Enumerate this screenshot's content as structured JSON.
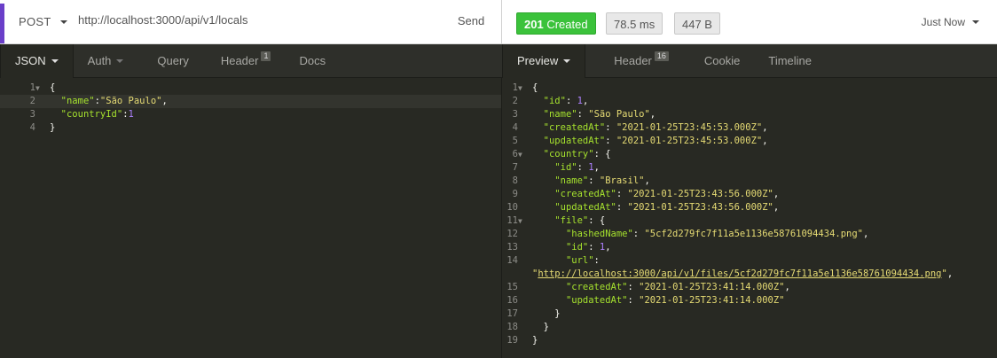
{
  "request": {
    "method": "POST",
    "url": "http://localhost:3000/api/v1/locals",
    "send_label": "Send",
    "tabs": [
      {
        "label": "JSON",
        "badge": ""
      },
      {
        "label": "Auth",
        "badge": ""
      },
      {
        "label": "Query",
        "badge": ""
      },
      {
        "label": "Header",
        "badge": "1"
      },
      {
        "label": "Docs",
        "badge": ""
      }
    ],
    "body_lines": [
      {
        "num": "1",
        "text": "{"
      },
      {
        "num": "2",
        "key": "\"name\"",
        "value": "\"São Paulo\"",
        "tail": ","
      },
      {
        "num": "3",
        "key": "\"countryId\"",
        "value": "1",
        "tail": ""
      },
      {
        "num": "4",
        "text": "}"
      }
    ]
  },
  "response": {
    "status_code": "201",
    "status_text": "Created",
    "time": "78.5 ms",
    "size": "447 B",
    "history_label": "Just Now",
    "tabs": [
      {
        "label": "Preview",
        "badge": ""
      },
      {
        "label": "Header",
        "badge": "16"
      },
      {
        "label": "Cookie",
        "badge": ""
      },
      {
        "label": "Timeline",
        "badge": ""
      }
    ],
    "lines": [
      {
        "num": "1",
        "indent": 0,
        "text": "{"
      },
      {
        "num": "2",
        "indent": 1,
        "key": "\"id\"",
        "num_value": "1",
        "tail": ","
      },
      {
        "num": "3",
        "indent": 1,
        "key": "\"name\"",
        "str_value": "\"São Paulo\"",
        "tail": ","
      },
      {
        "num": "4",
        "indent": 1,
        "key": "\"createdAt\"",
        "str_value": "\"2021-01-25T23:45:53.000Z\"",
        "tail": ","
      },
      {
        "num": "5",
        "indent": 1,
        "key": "\"updatedAt\"",
        "str_value": "\"2021-01-25T23:45:53.000Z\"",
        "tail": ","
      },
      {
        "num": "6",
        "indent": 1,
        "key": "\"country\"",
        "open": "{"
      },
      {
        "num": "7",
        "indent": 2,
        "key": "\"id\"",
        "num_value": "1",
        "tail": ","
      },
      {
        "num": "8",
        "indent": 2,
        "key": "\"name\"",
        "str_value": "\"Brasil\"",
        "tail": ","
      },
      {
        "num": "9",
        "indent": 2,
        "key": "\"createdAt\"",
        "str_value": "\"2021-01-25T23:43:56.000Z\"",
        "tail": ","
      },
      {
        "num": "10",
        "indent": 2,
        "key": "\"updatedAt\"",
        "str_value": "\"2021-01-25T23:43:56.000Z\"",
        "tail": ","
      },
      {
        "num": "11",
        "indent": 2,
        "key": "\"file\"",
        "open": "{"
      },
      {
        "num": "12",
        "indent": 3,
        "key": "\"hashedName\"",
        "str_value": "\"5cf2d279fc7f11a5e1136e58761094434.png\"",
        "tail": ","
      },
      {
        "num": "13",
        "indent": 3,
        "key": "\"id\"",
        "num_value": "1",
        "tail": ","
      },
      {
        "num": "14",
        "indent": 3,
        "key": "\"url\"",
        "colon_only": true
      },
      {
        "num": "",
        "indent": 0,
        "link_value": "http://localhost:3000/api/v1/files/5cf2d279fc7f11a5e1136e58761094434.png",
        "tail": ","
      },
      {
        "num": "15",
        "indent": 3,
        "key": "\"createdAt\"",
        "str_value": "\"2021-01-25T23:41:14.000Z\"",
        "tail": ","
      },
      {
        "num": "16",
        "indent": 3,
        "key": "\"updatedAt\"",
        "str_value": "\"2021-01-25T23:41:14.000Z\"",
        "tail": ""
      },
      {
        "num": "17",
        "indent": 2,
        "text": "}"
      },
      {
        "num": "18",
        "indent": 1,
        "text": "}"
      },
      {
        "num": "19",
        "indent": 0,
        "text": "}"
      }
    ]
  },
  "colors": {
    "accent": "#6a3fc9",
    "status_ok": "#3bc23b",
    "editor_bg": "#282923",
    "key": "#a6e22e",
    "string": "#e6db74",
    "number": "#ae81ff"
  },
  "icons": {
    "method_dropdown": "chevron-down-icon",
    "history_dropdown": "chevron-down-icon",
    "fold": "fold-arrow-icon"
  }
}
